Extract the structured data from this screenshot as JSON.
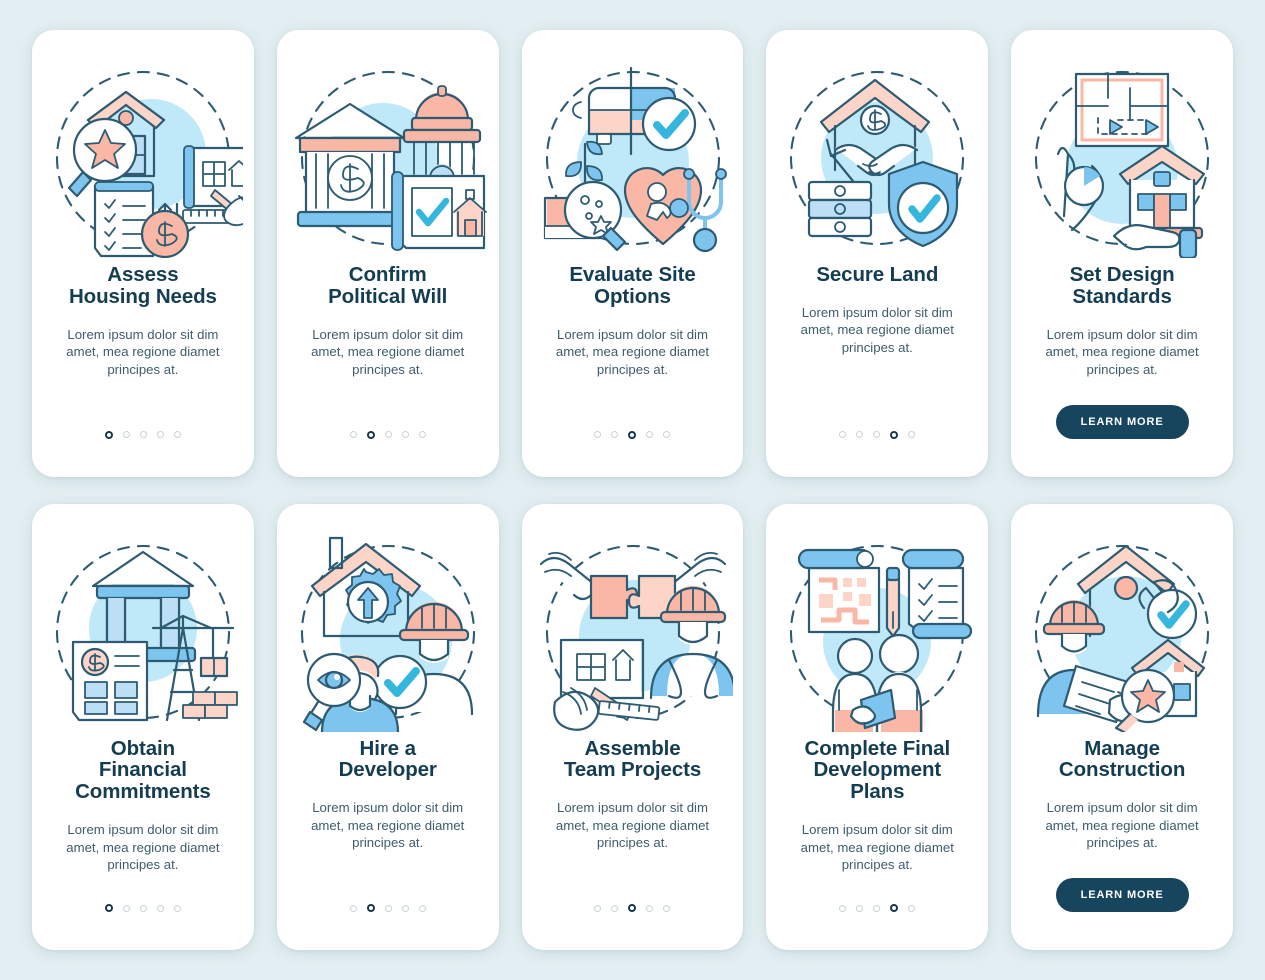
{
  "page": {
    "background_color": "#e2eef1",
    "card_background": "#ffffff",
    "title_color": "#153d52",
    "body_color": "#3e5c6b",
    "accent_pink": "#fbb7a6",
    "accent_blue": "#7dc4ee",
    "accent_blob": "#bfe9f9",
    "button_color": "#17455e",
    "dot_active_color": "#16384b",
    "dot_inactive_color": "#c8d2d7"
  },
  "shared": {
    "body_text": "Lorem ipsum dolor sit dim amet, mea regione diamet principes at.",
    "learn_more_label": "LEARN MORE",
    "dot_count": 5
  },
  "rows": [
    {
      "cards": [
        {
          "title": "Assess\nHousing Needs",
          "body": "Lorem ipsum dolor sit dim amet, mea regione diamet principes at.",
          "illustration": "house-magnifier-blueprint-checklist-dollar",
          "dots": {
            "count": 5,
            "active": 1
          },
          "has_button": false,
          "button_label": ""
        },
        {
          "title": "Confirm\nPolitical Will",
          "body": "Lorem ipsum dolor sit dim amet, mea regione diamet principes at.",
          "illustration": "bank-capitol-approved-permit",
          "dots": {
            "count": 5,
            "active": 2
          },
          "has_button": false,
          "button_label": ""
        },
        {
          "title": "Evaluate Site\nOptions",
          "body": "Lorem ipsum dolor sit dim amet, mea regione diamet principes at.",
          "illustration": "bus-plant-heart-stethoscope-magnifier",
          "dots": {
            "count": 5,
            "active": 3
          },
          "has_button": false,
          "button_label": ""
        },
        {
          "title": "Secure Land",
          "body": "Lorem ipsum dolor sit dim amet, mea regione diamet principes at.",
          "illustration": "handshake-house-money-shield-check",
          "dots": {
            "count": 5,
            "active": 4
          },
          "has_button": false,
          "button_label": ""
        },
        {
          "title": "Set Design\nStandards",
          "body": "Lorem ipsum dolor sit dim amet, mea regione diamet principes at.",
          "illustration": "floorplan-compass-house-hand",
          "dots": {
            "count": 0,
            "active": 0
          },
          "has_button": true,
          "button_label": "LEARN MORE"
        }
      ]
    },
    {
      "cards": [
        {
          "title": "Obtain\nFinancial\nCommitments",
          "body": "Lorem ipsum dolor sit dim amet, mea regione diamet principes at.",
          "illustration": "bank-invoice-crane-bricks",
          "dots": {
            "count": 5,
            "active": 1
          },
          "has_button": false,
          "button_label": ""
        },
        {
          "title": "Hire a\nDeveloper",
          "body": "Lorem ipsum dolor sit dim amet, mea regione diamet principes at.",
          "illustration": "house-gear-worker-magnifier-check",
          "dots": {
            "count": 5,
            "active": 2
          },
          "has_button": false,
          "button_label": ""
        },
        {
          "title": "Assemble\nTeam Projects",
          "body": "Lorem ipsum dolor sit dim amet, mea regione diamet principes at.",
          "illustration": "puzzle-hands-worker-blueprint-hand",
          "dots": {
            "count": 5,
            "active": 3
          },
          "has_button": false,
          "button_label": ""
        },
        {
          "title": "Complete Final\nDevelopment\nPlans",
          "body": "Lorem ipsum dolor sit dim amet, mea regione diamet principes at.",
          "illustration": "blueprint-pen-checklist-two-people",
          "dots": {
            "count": 5,
            "active": 4
          },
          "has_button": false,
          "button_label": ""
        },
        {
          "title": "Manage\nConstruction",
          "body": "Lorem ipsum dolor sit dim amet, mea regione diamet principes at.",
          "illustration": "worker-clipboard-house-star-magnifier",
          "dots": {
            "count": 0,
            "active": 0
          },
          "has_button": true,
          "button_label": "LEARN MORE"
        }
      ]
    }
  ]
}
